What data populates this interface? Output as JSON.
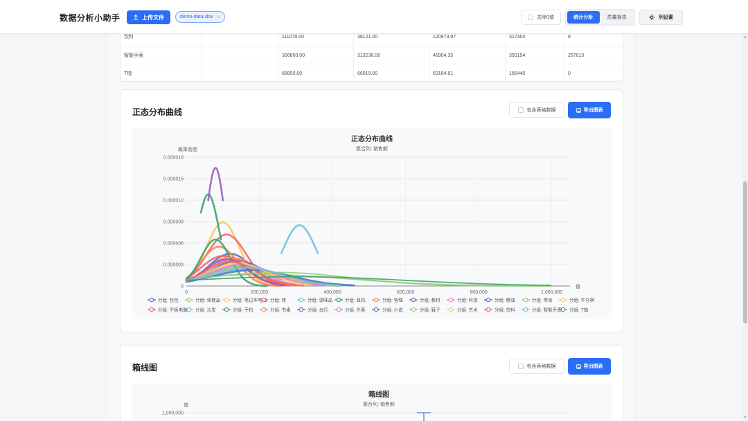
{
  "header": {
    "app_title": "数据分析小助手",
    "upload_label": "上传文件",
    "file_chip": "demo-data.xlsx",
    "file_chip_close": "×",
    "remove_zero_label": "去除0值",
    "tabs": [
      {
        "label": "统计分析",
        "active": true
      },
      {
        "label": "质量报告",
        "active": false
      }
    ],
    "column_settings_label": "列设置"
  },
  "table": {
    "rows": [
      {
        "name": "饮料",
        "c1": "",
        "c2": "111079.00",
        "c3": "38121.00",
        "c4": "120973.97",
        "c5": "317304",
        "c6": "8"
      },
      {
        "name": "智能手表",
        "c1": "",
        "c2": "306800.00",
        "c3": "313236.00",
        "c4": "46904.35",
        "c5": "350154",
        "c6": "257010"
      },
      {
        "name": "T恤",
        "c1": "",
        "c2": "68850.00",
        "c3": "66015.00",
        "c4": "63184.81",
        "c5": "166440",
        "c6": "0"
      }
    ]
  },
  "normal_card": {
    "title": "正态分布曲线",
    "include_table_label": "包含表格数据",
    "export_label": "导出图表"
  },
  "box_card": {
    "title": "箱线图",
    "include_table_label": "包含表格数据",
    "export_label": "导出图表"
  },
  "chart_data": [
    {
      "type": "line",
      "title": "正态分布曲线",
      "subtitle": "聚合列: 销售额",
      "ylabel": "概率密度",
      "xlabel": "值",
      "xlim": [
        0,
        1050000
      ],
      "ylim": [
        0,
        1.8e-05
      ],
      "x_ticks": [
        "0",
        "200,000",
        "400,000",
        "600,000",
        "800,000",
        "1,000,000"
      ],
      "y_ticks": [
        "0",
        "0.000003",
        "0.000006",
        "0.000009",
        "0.000012",
        "0.000015",
        "0.000018"
      ],
      "grid": true,
      "legend_position": "bottom",
      "series": [
        {
          "name": "分组: 包包",
          "color": "#5470c6",
          "mean": 120000,
          "sd": 60000,
          "x_range": [
            0,
            260000
          ],
          "peak": 4.5e-06
        },
        {
          "name": "分组: 保健品",
          "color": "#91cc75",
          "mean": 150000,
          "sd": 90000,
          "x_range": [
            0,
            420000
          ],
          "peak": 2.8e-06
        },
        {
          "name": "分组: 笔记本电脑",
          "color": "#fac858",
          "mean": 100000,
          "sd": 45000,
          "x_range": [
            20000,
            250000
          ],
          "peak": 8.9e-06
        },
        {
          "name": "分组: 床",
          "color": "#ee6666",
          "mean": 110000,
          "sd": 55000,
          "x_range": [
            0,
            280000
          ],
          "peak": 7.2e-06
        },
        {
          "name": "分组: 调味品",
          "color": "#73c0de",
          "mean": 310000,
          "sd": 45000,
          "x_range": [
            260000,
            360000
          ],
          "peak": 8.5e-06
        },
        {
          "name": "分组: 耳机",
          "color": "#3ba272",
          "mean": 60000,
          "sd": 30000,
          "x_range": [
            40000,
            95000
          ],
          "peak": 1.28e-05
        },
        {
          "name": "分组: 管理",
          "color": "#fc8452",
          "mean": 90000,
          "sd": 50000,
          "x_range": [
            0,
            260000
          ],
          "peak": 5.5e-06
        },
        {
          "name": "分组: 教材",
          "color": "#9a60b4",
          "mean": 80000,
          "sd": 25000,
          "x_range": [
            60000,
            100000
          ],
          "peak": 1.65e-05
        },
        {
          "name": "分组: 科技",
          "color": "#ea7ccc",
          "mean": 130000,
          "sd": 70000,
          "x_range": [
            0,
            300000
          ],
          "peak": 3.8e-06
        },
        {
          "name": "分组: 糖油",
          "color": "#5470c6",
          "mean": 140000,
          "sd": 75000,
          "x_range": [
            0,
            260000
          ],
          "peak": 3.5e-06
        },
        {
          "name": "分组: 零食",
          "color": "#91cc75",
          "mean": 200000,
          "sd": 250000,
          "x_range": [
            0,
            1000000
          ],
          "peak": 1.6e-06
        },
        {
          "name": "分组: 牛仔裤",
          "color": "#fac858",
          "mean": 160000,
          "sd": 95000,
          "x_range": [
            0,
            400000
          ],
          "peak": 2.5e-06
        },
        {
          "name": "分组: 平板电脑",
          "color": "#ee6666",
          "mean": 100000,
          "sd": 60000,
          "x_range": [
            0,
            260000
          ],
          "peak": 4.2e-06
        },
        {
          "name": "分组: 沙发",
          "color": "#73c0de",
          "mean": 170000,
          "sd": 100000,
          "x_range": [
            0,
            450000
          ],
          "peak": 2.4e-06
        },
        {
          "name": "分组: 手机",
          "color": "#3ba272",
          "mean": 80000,
          "sd": 40000,
          "x_range": [
            0,
            220000
          ],
          "peak": 6.5e-06
        },
        {
          "name": "分组: 书桌",
          "color": "#fc8452",
          "mean": 120000,
          "sd": 65000,
          "x_range": [
            0,
            300000
          ],
          "peak": 4e-06
        },
        {
          "name": "分组: 台灯",
          "color": "#9a60b4",
          "mean": 110000,
          "sd": 60000,
          "x_range": [
            0,
            270000
          ],
          "peak": 3.7e-06
        },
        {
          "name": "分组: 外套",
          "color": "#ea7ccc",
          "mean": 150000,
          "sd": 85000,
          "x_range": [
            0,
            380000
          ],
          "peak": 3e-06
        },
        {
          "name": "分组: 小说",
          "color": "#5470c6",
          "mean": 180000,
          "sd": 110000,
          "x_range": [
            0,
            460000
          ],
          "peak": 2.2e-06
        },
        {
          "name": "分组: 鞋子",
          "color": "#91cc75",
          "mean": 250000,
          "sd": 200000,
          "x_range": [
            0,
            1000000
          ],
          "peak": 1.9e-06
        },
        {
          "name": "分组: 艺术",
          "color": "#fac858",
          "mean": 140000,
          "sd": 80000,
          "x_range": [
            0,
            340000
          ],
          "peak": 3.2e-06
        },
        {
          "name": "分组: 饮料",
          "color": "#ee6666",
          "mean": 120000,
          "sd": 70000,
          "x_range": [
            0,
            320000
          ],
          "peak": 3.4e-06
        },
        {
          "name": "分组: 智能手表",
          "color": "#73c0de",
          "mean": 160000,
          "sd": 100000,
          "x_range": [
            0,
            420000
          ],
          "peak": 2.6e-06
        },
        {
          "name": "分组: T恤",
          "color": "#3ba272",
          "mean": 300000,
          "sd": 300000,
          "x_range": [
            0,
            1000000
          ],
          "peak": 1.3e-06
        }
      ]
    },
    {
      "type": "box",
      "title": "箱线图",
      "subtitle": "聚合列: 销售额",
      "ylabel": "值",
      "y_ticks": [
        "1,000,000"
      ]
    }
  ]
}
